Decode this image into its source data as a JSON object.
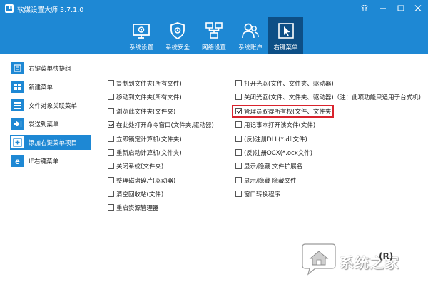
{
  "window": {
    "title": "软媒设置大师 3.7.1.0"
  },
  "toolbar": {
    "items": [
      {
        "label": "系统设置",
        "icon": "gear-monitor-icon"
      },
      {
        "label": "系统安全",
        "icon": "shield-gear-icon"
      },
      {
        "label": "网络设置",
        "icon": "network-icon"
      },
      {
        "label": "系统账户",
        "icon": "users-icon"
      },
      {
        "label": "右键菜单",
        "icon": "cursor-click-icon",
        "active": true
      }
    ]
  },
  "sidebar": {
    "items": [
      {
        "label": "右键菜单快捷组"
      },
      {
        "label": "新建菜单"
      },
      {
        "label": "文件对象关联菜单"
      },
      {
        "label": "发送到菜单"
      },
      {
        "label": "添加右键菜单项目",
        "active": true
      },
      {
        "label": "IE右键菜单"
      }
    ]
  },
  "options": {
    "left": [
      {
        "label": "复制到文件夹(所有文件)",
        "checked": false
      },
      {
        "label": "移动到文件夹(所有文件)",
        "checked": false
      },
      {
        "label": "浏览此文件夹(文件夹)",
        "checked": false
      },
      {
        "label": "在此处打开命令窗口(文件夹,驱动器)",
        "checked": true
      },
      {
        "label": "立即锁定计算机(文件夹)",
        "checked": false
      },
      {
        "label": "重新启动计算机(文件夹)",
        "checked": false
      },
      {
        "label": "关闭系统(文件夹)",
        "checked": false
      },
      {
        "label": "整理磁盘碎片(驱动器)",
        "checked": false
      },
      {
        "label": "清空回收站(文件)",
        "checked": false
      },
      {
        "label": "重启资源管理器",
        "checked": false
      }
    ],
    "right": [
      {
        "label": "打开光驱(文件、文件夹、驱动器)",
        "checked": false
      },
      {
        "label": "关闭光驱(文件、文件夹、驱动器)（注：此项功能只适用于台式机)",
        "checked": false
      },
      {
        "label": "管理员取得所有权(文件、文件夹)",
        "checked": true
      },
      {
        "label": "用记事本打开该文件(文件)",
        "checked": false
      },
      {
        "label": "(反)注册DLL(*.dll文件)",
        "checked": false
      },
      {
        "label": "(反)注册OCX(*.ocx文件)",
        "checked": false
      },
      {
        "label": "显示/隐藏 文件扩展名",
        "checked": false
      },
      {
        "label": "显示/隐藏 隐藏文件",
        "checked": false
      },
      {
        "label": "窗口转换程序",
        "checked": false
      }
    ]
  },
  "watermark": {
    "text": "系统之家",
    "peek": "(R)"
  },
  "colors": {
    "accent": "#1e88d4",
    "active_tab": "#0d4f86",
    "highlight": "#d9232d"
  }
}
